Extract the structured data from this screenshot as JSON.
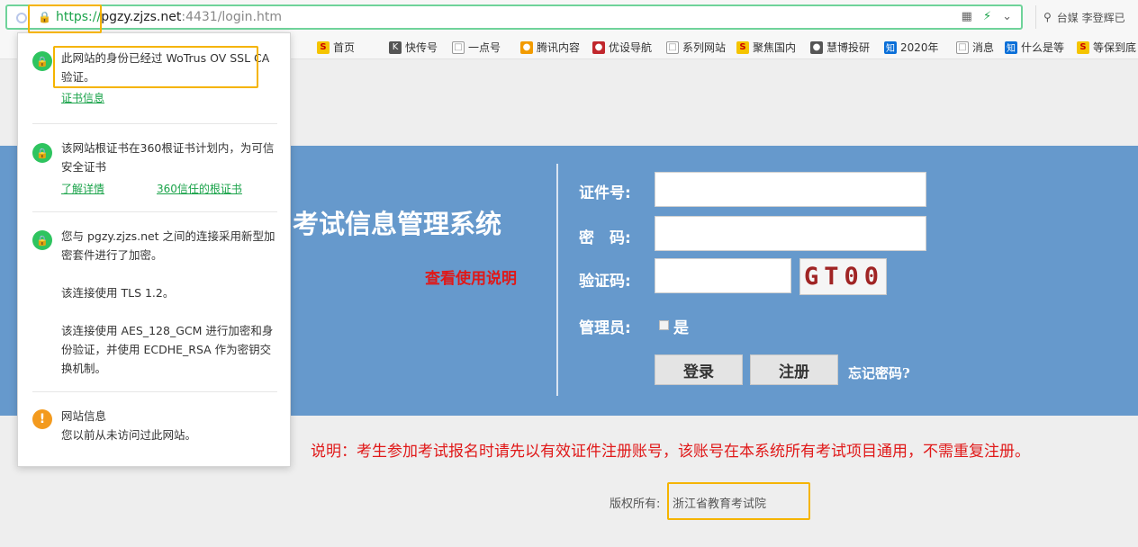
{
  "browser": {
    "url_scheme": "https://",
    "url_host": "pgzy.zjzs.net",
    "url_rest": ":4431/login.htm",
    "search_text": "台媒 李登辉已"
  },
  "bookmarks": [
    {
      "label": "首页",
      "icon": "s"
    },
    {
      "label": "快传号",
      "icon": "k"
    },
    {
      "label": "一点号",
      "icon": "doc"
    },
    {
      "label": "腾讯内容",
      "icon": "c"
    },
    {
      "label": "优设导航",
      "icon": "r"
    },
    {
      "label": "系列网站",
      "icon": "doc"
    },
    {
      "label": "聚焦国内",
      "icon": "s"
    },
    {
      "label": "慧博投研",
      "icon": "k"
    },
    {
      "label": "2020年",
      "icon": "zhi"
    },
    {
      "label": "消息",
      "icon": "doc"
    },
    {
      "label": "什么是等",
      "icon": "zhi"
    },
    {
      "label": "等保到底",
      "icon": "s"
    }
  ],
  "popup": {
    "identity_text": "此网站的身份已经过 WoTrus OV SSL CA 验证。",
    "cert_info_link": "证书信息",
    "root_text": "该网站根证书在360根证书计划内，为可信安全证书",
    "learn_more_link": "了解详情",
    "trusted_roots_link": "360信任的根证书",
    "conn_text": "您与 pgzy.zjzs.net 之间的连接采用新型加密套件进行了加密。",
    "tls_text": "该连接使用 TLS 1.2。",
    "cipher_text": "该连接使用 AES_128_GCM 进行加密和身份验证，并使用 ECDHE_RSA 作为密钥交换机制。",
    "site_info_title": "网站信息",
    "site_info_text": "您以前从未访问过此网站。"
  },
  "page": {
    "system_title": "考试信息管理系统",
    "help_link": "查看使用说明",
    "id_label": "证件号:",
    "password_label": "密　码:",
    "captcha_label": "验证码:",
    "captcha_text": "GT00",
    "admin_label": "管理员:",
    "admin_option": "是",
    "login_button": "登录",
    "register_button": "注册",
    "forgot_link": "忘记密码?",
    "notice": "说明：考生参加考试报名时请先以有效证件注册账号，该账号在本系统所有考试项目通用，不需重复注册。",
    "copyright_label": "版权所有:",
    "copyright_value": "浙江省教育考试院"
  },
  "colors": {
    "band": "#6699cc",
    "highlight": "#f5b400",
    "secure_green": "#1aa34a",
    "notice_red": "#e01818"
  }
}
